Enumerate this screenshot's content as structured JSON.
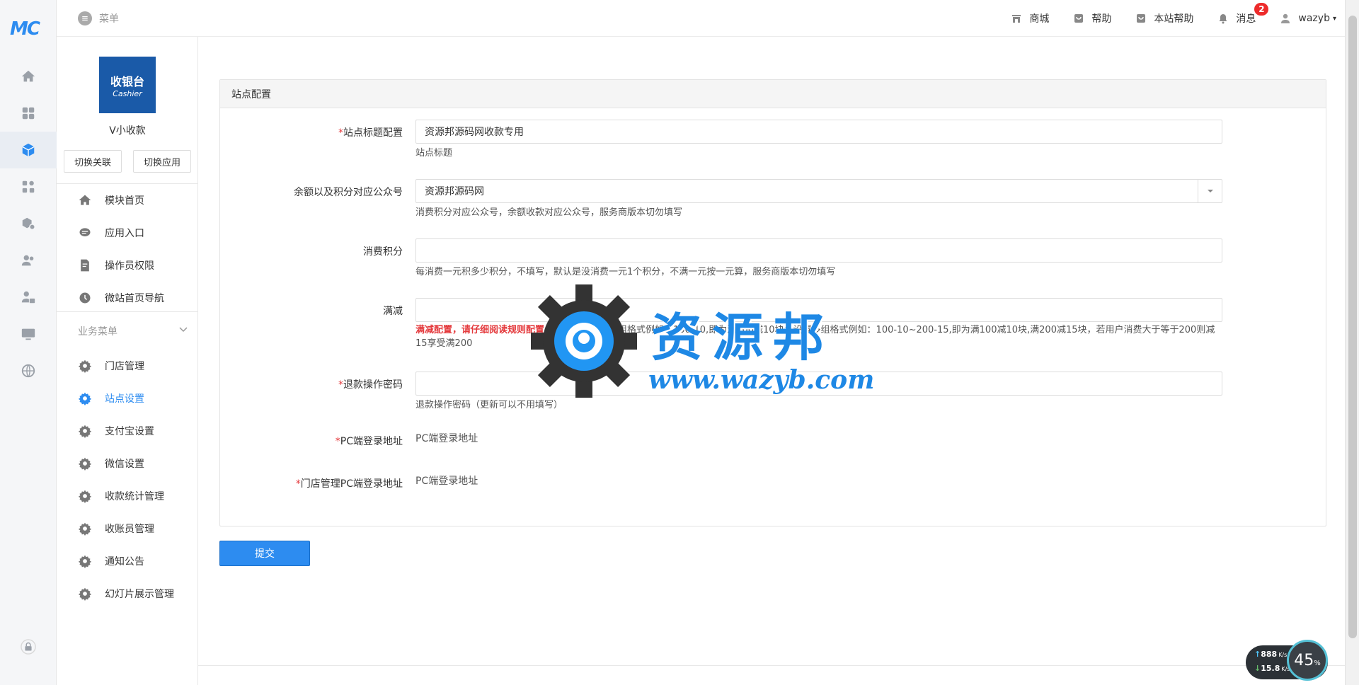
{
  "brand": {
    "logo_text": "MC"
  },
  "topbar": {
    "menu_label": "菜单",
    "nav": [
      {
        "label": "商城",
        "icon": "shop-icon"
      },
      {
        "label": "帮助",
        "icon": "help-icon"
      },
      {
        "label": "本站帮助",
        "icon": "site-help-icon"
      },
      {
        "label": "消息",
        "icon": "bell-icon",
        "badge": "2"
      }
    ],
    "user": "wazyb"
  },
  "sidebar": {
    "app_logo_line1": "收银台",
    "app_logo_line2": "Cashier",
    "app_name": "V小收款",
    "switch_link": "切换关联",
    "switch_app": "切换应用",
    "items": [
      {
        "label": "模块首页",
        "icon": "home-icon"
      },
      {
        "label": "应用入口",
        "icon": "chat-icon"
      },
      {
        "label": "操作员权限",
        "icon": "edit-doc-icon"
      },
      {
        "label": "微站首页导航",
        "icon": "compass-icon"
      }
    ],
    "group_title": "业务菜单",
    "group_items": [
      {
        "label": "门店管理",
        "active": false
      },
      {
        "label": "站点设置",
        "active": true
      },
      {
        "label": "支付宝设置",
        "active": false
      },
      {
        "label": "微信设置",
        "active": false
      },
      {
        "label": "收款统计管理",
        "active": false
      },
      {
        "label": "收账员管理",
        "active": false
      },
      {
        "label": "通知公告",
        "active": false
      },
      {
        "label": "幻灯片展示管理",
        "active": false
      }
    ]
  },
  "form": {
    "panel_title": "站点配置",
    "title_label": "站点标题配置",
    "title_value": "资源邦源码网收款专用",
    "title_help": "站点标题",
    "account_label": "余额以及积分对应公众号",
    "account_value": "资源邦源码网",
    "account_help": "消费积分对应公众号，余额收款对应公众号，服务商版本切勿填写",
    "points_label": "消费积分",
    "points_value": "",
    "points_help": "每消费一元积多少积分，不填写，默认是没消费一元1个积分，不满一元按一元算，服务商版本切勿填写",
    "discount_label": "满减",
    "discount_value": "",
    "discount_help_warn": "满减配置，请仔细阅读规则配置，",
    "discount_help_rest": "可为空，设置一组格式例如：100-10,即为满100减10块；设置多组格式例如：100-10~200-15,即为满100减10块,满200减15块，若用户消费大于等于200则减15享受满200",
    "refund_label": "退款操作密码",
    "refund_value": "",
    "refund_help": "退款操作密码（更新可以不用填写）",
    "pc_label": "PC端登录地址",
    "pc_value": "PC端登录地址",
    "store_pc_label": "门店管理PC端登录地址",
    "store_pc_value": "PC端登录地址",
    "submit": "提交"
  },
  "watermark": {
    "cn": "资源邦",
    "url": "www.wazyb.com"
  },
  "speed_widget": {
    "up": "888",
    "up_unit": "K/s",
    "down": "15.8",
    "down_unit": "K/s",
    "percent": "45",
    "percent_unit": "%"
  },
  "colors": {
    "accent": "#2d8cf0",
    "required": "#e4393c",
    "badge": "#ed2b2b"
  }
}
